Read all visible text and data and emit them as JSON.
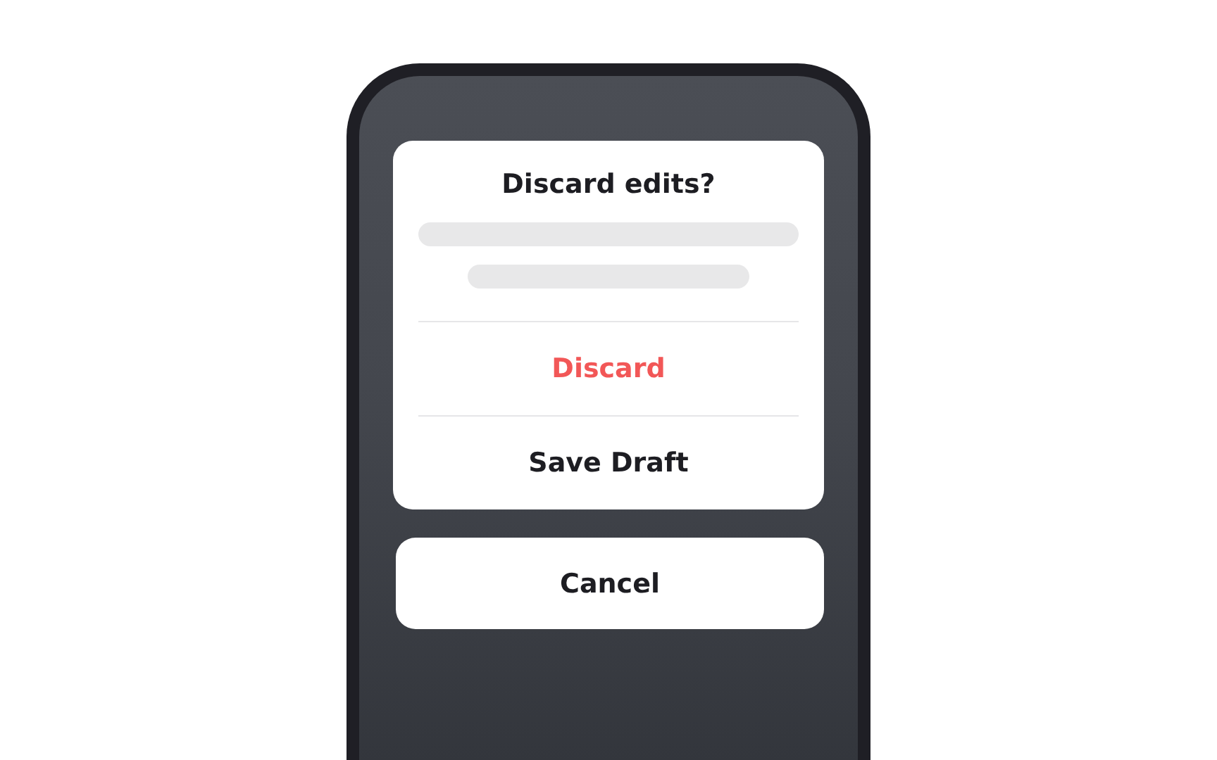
{
  "dialog": {
    "title": "Discard edits?",
    "actions": [
      {
        "label": "Discard",
        "kind": "destructive"
      },
      {
        "label": "Save Draft",
        "kind": "default"
      }
    ]
  },
  "cancel_button": {
    "label": "Cancel"
  }
}
